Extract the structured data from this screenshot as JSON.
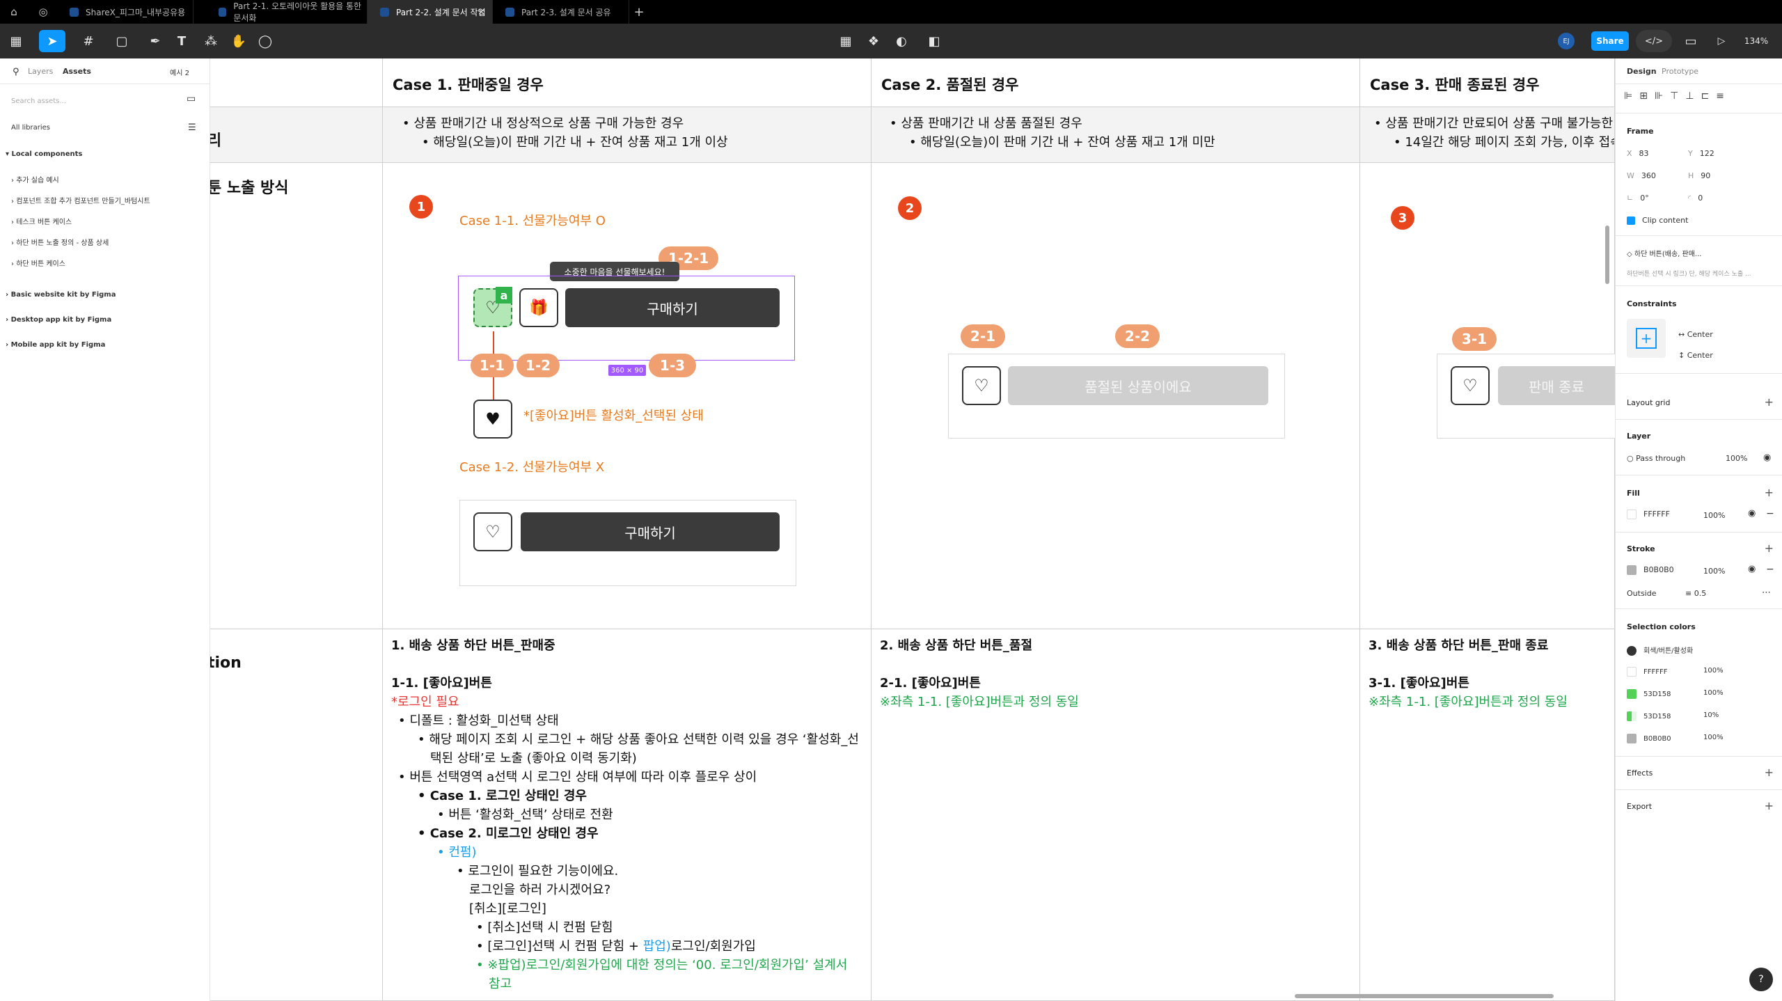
{
  "tabs": [
    {
      "label": "ShareX_피그마_내부공유용",
      "active": false
    },
    {
      "label": "Part 2-1. 오토레이아웃 활용을 통한 문서화",
      "active": false
    },
    {
      "label": "Part 2-2. 설계 문서 작업",
      "active": true
    },
    {
      "label": "Part 2-3. 설계 문서 공유",
      "active": false
    }
  ],
  "toolbar": {
    "share_label": "Share",
    "zoom": "134%",
    "avatar": "EJ"
  },
  "left_panel": {
    "tab_layers": "Layers",
    "tab_assets": "Assets",
    "page_select": "예시 2",
    "search_placeholder": "Search assets...",
    "libraries": "All libraries",
    "local_components": "Local components",
    "items": [
      "추가 실습 예시",
      "컴포넌트 조합 추가 컴포넌트 만들기_바텀시트",
      "테스크 버튼 케이스",
      "하단 버튼 노출 정의 - 상품 상세",
      "하단 버튼 케이스"
    ],
    "kits": [
      "Basic website kit by Figma",
      "Desktop app kit by Figma",
      "Mobile app kit by Figma"
    ]
  },
  "canvas": {
    "left_headers": [
      "리",
      "툰 노출 방식",
      "tion"
    ],
    "cases": [
      {
        "title": "Case 1. 판매중일 경우",
        "line1": "상품 판매기간 내 정상적으로 상품 구매 가능한 경우",
        "line2": "해당일(오늘)이 판매 기간 내 + 잔여 상품 재고 1개 이상"
      },
      {
        "title": "Case 2. 품절된 경우",
        "line1": "상품 판매기간 내 상품 품절된 경우",
        "line2": "해당일(오늘)이 판매 기간 내 + 잔여 상품 재고 1개 미만"
      },
      {
        "title": "Case 3. 판매 종료된 경우",
        "line1": "상품 판매기간 만료되어 상품 구매 불가능한",
        "line2": "14일간 해당 페이지 조회 가능, 이후 접속"
      }
    ],
    "badges": [
      "1",
      "2",
      "3"
    ],
    "case1_1": "Case 1-1. 선물가능여부 O",
    "case1_2": "Case 1-2. 선물가능여부 X",
    "tooltip": "소중한 마음을 선물해보세요!",
    "buy_label": "구매하기",
    "soldout_label": "품절된 상품이에요",
    "ended_label": "판매 종료",
    "pill_121": "1-2-1",
    "pill_11": "1-1",
    "pill_12": "1-2",
    "pill_13": "1-3",
    "pill_21": "2-1",
    "pill_22": "2-2",
    "pill_31": "3-1",
    "size_badge": "360 × 90",
    "a_label": "a",
    "like_active": "*[좋아요]버튼 활성화_선택된 상태",
    "desc1": {
      "title": "1. 배송 상품 하단 버튼_판매중",
      "sub": "1-1. [좋아요]버튼",
      "login": "*로그인 필요",
      "l1": "디폴트 : 활성화_미선택 상태",
      "l2": "해당 페이지 조회 시 로그인 + 해당 상품 좋아요 선택한 이력 있을 경우 ‘활성화_선",
      "l2b": "택된 상태’로 노출 (좋아요 이력 동기화)",
      "l3": "버튼 선택영역 a선택 시 로그인 상태 여부에 따라 이후 플로우 상이",
      "c1": "Case 1. 로그인 상태인 경우",
      "c1a": "버튼 ‘활성화_선택’ 상태로 전환",
      "c2": "Case 2. 미로그인 상태인 경우",
      "confirm": "컨펌)",
      "m1": "로그인이 필요한 기능이에요.",
      "m2": "로그인을 하러 가시겠어요?",
      "m3": "[취소][로그인]",
      "m4": "[취소]선택 시 컨펌 닫힘",
      "m5a": "[로그인]선택 시 컨펌 닫힘 + ",
      "m5b": "팝업)",
      "m5c": "로그인/회원가입",
      "m6": "※팝업)로그인/회원가입에 대한 정의는 ‘00. 로그인/회원가입’ 설계서",
      "m6b": "참고"
    },
    "desc2": {
      "title": "2. 배송 상품 하단 버튼_품절",
      "sub": "2-1. [좋아요]버튼",
      "note": "※좌측 1-1. [좋아요]버튼과 정의 동일"
    },
    "desc3": {
      "title": "3. 배송 상품 하단 버튼_판매 종료",
      "sub": "3-1. [좋아요]버튼",
      "note": "※좌측 1-1. [좋아요]버튼과 정의 동일"
    }
  },
  "right_panel": {
    "tab_design": "Design",
    "tab_prototype": "Prototype",
    "frame_label": "Frame",
    "x": "83",
    "y": "122",
    "w": "360",
    "h": "90",
    "rotation": "0°",
    "radius": "0",
    "clip": "Clip content",
    "component": "하단 버튼(배송, 판매...",
    "component_desc": "하단버튼 선택 시 링크) 단, 해당 케이스 노출 ...",
    "constraints": "Constraints",
    "c_h": "Center",
    "c_v": "Center",
    "layout_grid": "Layout grid",
    "layer": "Layer",
    "blend": "Pass through",
    "layer_opacity": "100%",
    "fill": "Fill",
    "fill_hex": "FFFFFF",
    "fill_opacity": "100%",
    "stroke": "Stroke",
    "stroke_hex": "B0B0B0",
    "stroke_opacity": "100%",
    "stroke_pos": "Outside",
    "stroke_w": "0.5",
    "selection_colors": "Selection colors",
    "colors": [
      {
        "name": "회색/버튼/활성화",
        "opacity": "",
        "color": "#333333"
      },
      {
        "name": "FFFFFF",
        "opacity": "100%",
        "color": "#FFFFFF"
      },
      {
        "name": "53D158",
        "opacity": "100%",
        "color": "#53D158"
      },
      {
        "name": "53D158",
        "opacity": "10%",
        "color": "#53D158"
      },
      {
        "name": "B0B0B0",
        "opacity": "100%",
        "color": "#B0B0B0"
      }
    ],
    "effects": "Effects",
    "export": "Export"
  }
}
